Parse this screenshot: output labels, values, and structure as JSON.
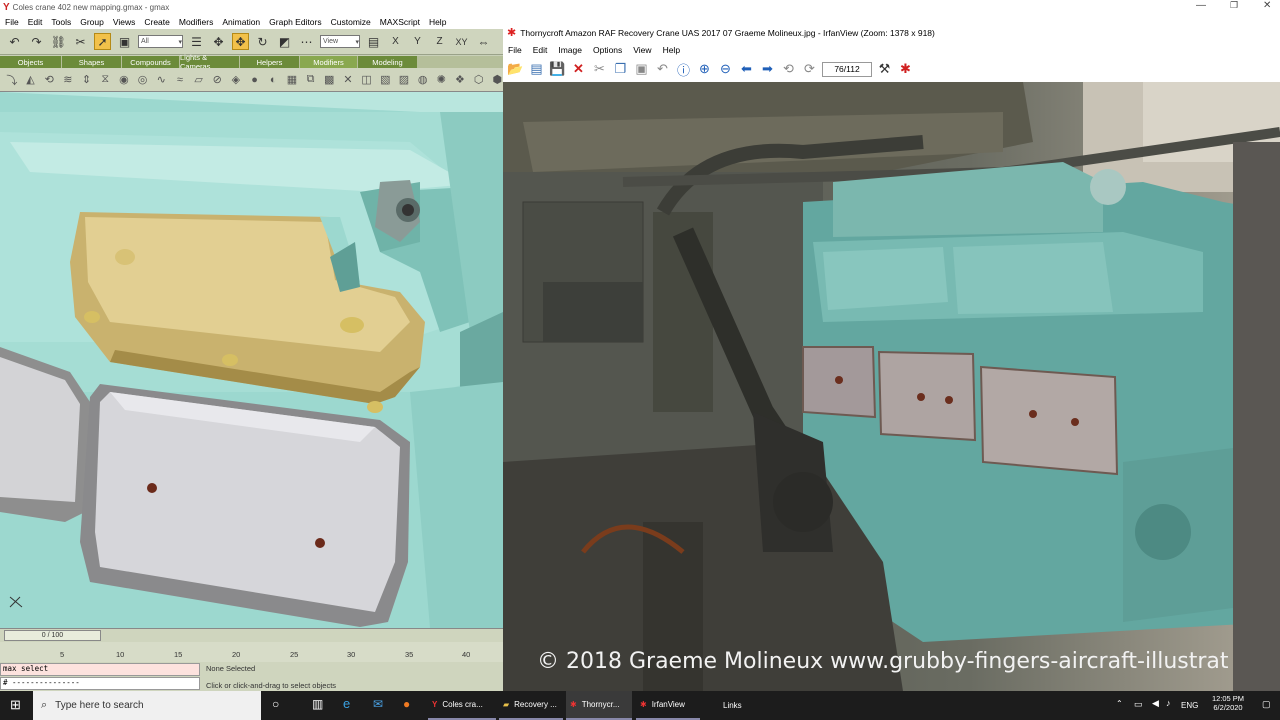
{
  "gmax": {
    "title": "Coles crane 402 new mapping.gmax - gmax",
    "menu": [
      "File",
      "Edit",
      "Tools",
      "Group",
      "Views",
      "Create",
      "Modifiers",
      "Animation",
      "Graph Editors",
      "Customize",
      "MAXScript",
      "Help"
    ],
    "selection_filter": "All",
    "ref_coord": "View",
    "axis_buttons": [
      "X",
      "Y",
      "Z",
      "XY"
    ],
    "tabs": [
      "Objects",
      "Shapes",
      "Compounds",
      "Lights & Cameras",
      "Helpers",
      "Modifiers",
      "Modeling"
    ],
    "active_tab": "Modifiers",
    "time_slider": "0 / 100",
    "ruler_ticks": [
      "5",
      "10",
      "15",
      "20",
      "25",
      "30",
      "35",
      "40"
    ],
    "maxscript_listener": "max select",
    "maxscript_input": "# ---------------",
    "selection_status": "None Selected",
    "prompt": "Click or click-and-drag to select objects"
  },
  "irfanview": {
    "title": "Thornycroft Amazon RAF Recovery Crane UAS 2017 07 Graeme Molineux.jpg - IrfanView (Zoom: 1378 x 918)",
    "menu": [
      "File",
      "Edit",
      "Image",
      "Options",
      "View",
      "Help"
    ],
    "page_counter": "76/112",
    "watermark": "© 2018 Graeme Molineux www.grubby-fingers-aircraft-illustrat"
  },
  "taskbar": {
    "search_placeholder": "Type here to search",
    "apps": [
      {
        "label": "Coles cra..."
      },
      {
        "label": "Recovery ..."
      },
      {
        "label": "Thornycr..."
      },
      {
        "label": "IrfanView"
      }
    ],
    "links": "Links",
    "language": "ENG",
    "time": "12:05 PM",
    "date": "6/2/2020"
  },
  "colors": {
    "viewport_teal": "#9cd8cf",
    "object_gold": "#d1bc7a",
    "gmax_green": "#6c8b3a",
    "highlight": "#f2c14a"
  }
}
